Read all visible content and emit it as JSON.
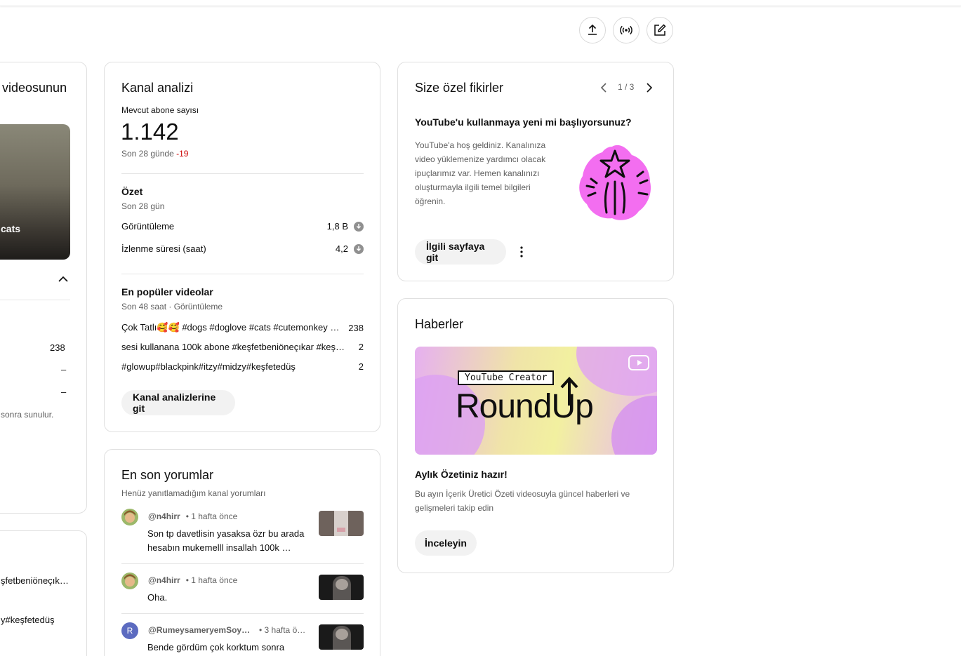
{
  "toolbar": {
    "upload_icon": "upload-icon",
    "live_icon": "live-icon",
    "create_post_icon": "edit-icon"
  },
  "left_card": {
    "title_fragment": "videosunun",
    "thumbnail_caption": "cats",
    "stats": [
      "238",
      "–",
      "–"
    ],
    "note_fragment": "sonra sunulur."
  },
  "left_card_2": {
    "items": [
      "şfetbeniöneçıka…",
      "y#keşfetedüş"
    ]
  },
  "analytics": {
    "title": "Kanal analizi",
    "subscribers_label": "Mevcut abone sayısı",
    "subscribers_value": "1.142",
    "period_prefix": "Son 28 günde",
    "period_delta": "-19",
    "summary_title": "Özet",
    "summary_period": "Son 28 gün",
    "metrics": [
      {
        "label": "Görüntüleme",
        "value": "1,8 B"
      },
      {
        "label": "İzlenme süresi (saat)",
        "value": "4,2"
      }
    ],
    "top_title": "En popüler videolar",
    "top_period": "Son 48 saat · Görüntüleme",
    "top_videos": [
      {
        "title": "Çok Tatlı🥰🥰 #dogs #doglove #cats #cutemonkey …",
        "views": "238"
      },
      {
        "title": "sesi kullanana 100k abone #keşfetbeniöneçıkar #keş…",
        "views": "2"
      },
      {
        "title": "#glowup#blackpink#itzy#midzy#keşfetedüş",
        "views": "2"
      }
    ],
    "button": "Kanal analizlerine git"
  },
  "comments": {
    "title": "En son yorumlar",
    "subtitle": "Henüz yanıtlamadığım kanal yorumları",
    "items": [
      {
        "author": "@n4hirr",
        "time": "• 1 hafta önce",
        "text_line1": "Son tp davetlisin yasaksa özr bu arada",
        "text_line2": "hesabın mukemelll insallah 100k …"
      },
      {
        "author": "@n4hirr",
        "time": "• 1 hafta önce",
        "text_line1": "Oha.",
        "text_line2": ""
      },
      {
        "author": "@RumeysameryemSoy…",
        "time": "• 3 hafta ö…",
        "text_line1": "Bende gördüm çok korktum sonra",
        "text_line2": "",
        "avatar_letter": "R"
      }
    ]
  },
  "ideas": {
    "title": "Size özel fikirler",
    "pager": "1 / 3",
    "heading": "YouTube'u kullanmaya yeni mi başlıyorsunuz?",
    "body": "YouTube'a hoş geldiniz. Kanalınıza video yüklemenize yardımcı olacak ipuçlarımız var. Hemen kanalınızı oluşturmayla ilgili temel bilgileri öğrenin.",
    "button": "İlgili sayfaya git"
  },
  "news": {
    "title": "Haberler",
    "banner_tag": "YouTube Creator",
    "banner_title": "RoundUp",
    "heading": "Aylık Özetiniz hazır!",
    "body": "Bu ayın İçerik Üretici Özeti videosuyla güncel haberleri ve gelişmeleri takip edin",
    "button": "İnceleyin"
  },
  "colors": {
    "negative": "#cc0000",
    "pill_bg": "#f2f2f2",
    "card_border": "#e0e0e0",
    "sparkle_pink": "#f36ef0"
  }
}
